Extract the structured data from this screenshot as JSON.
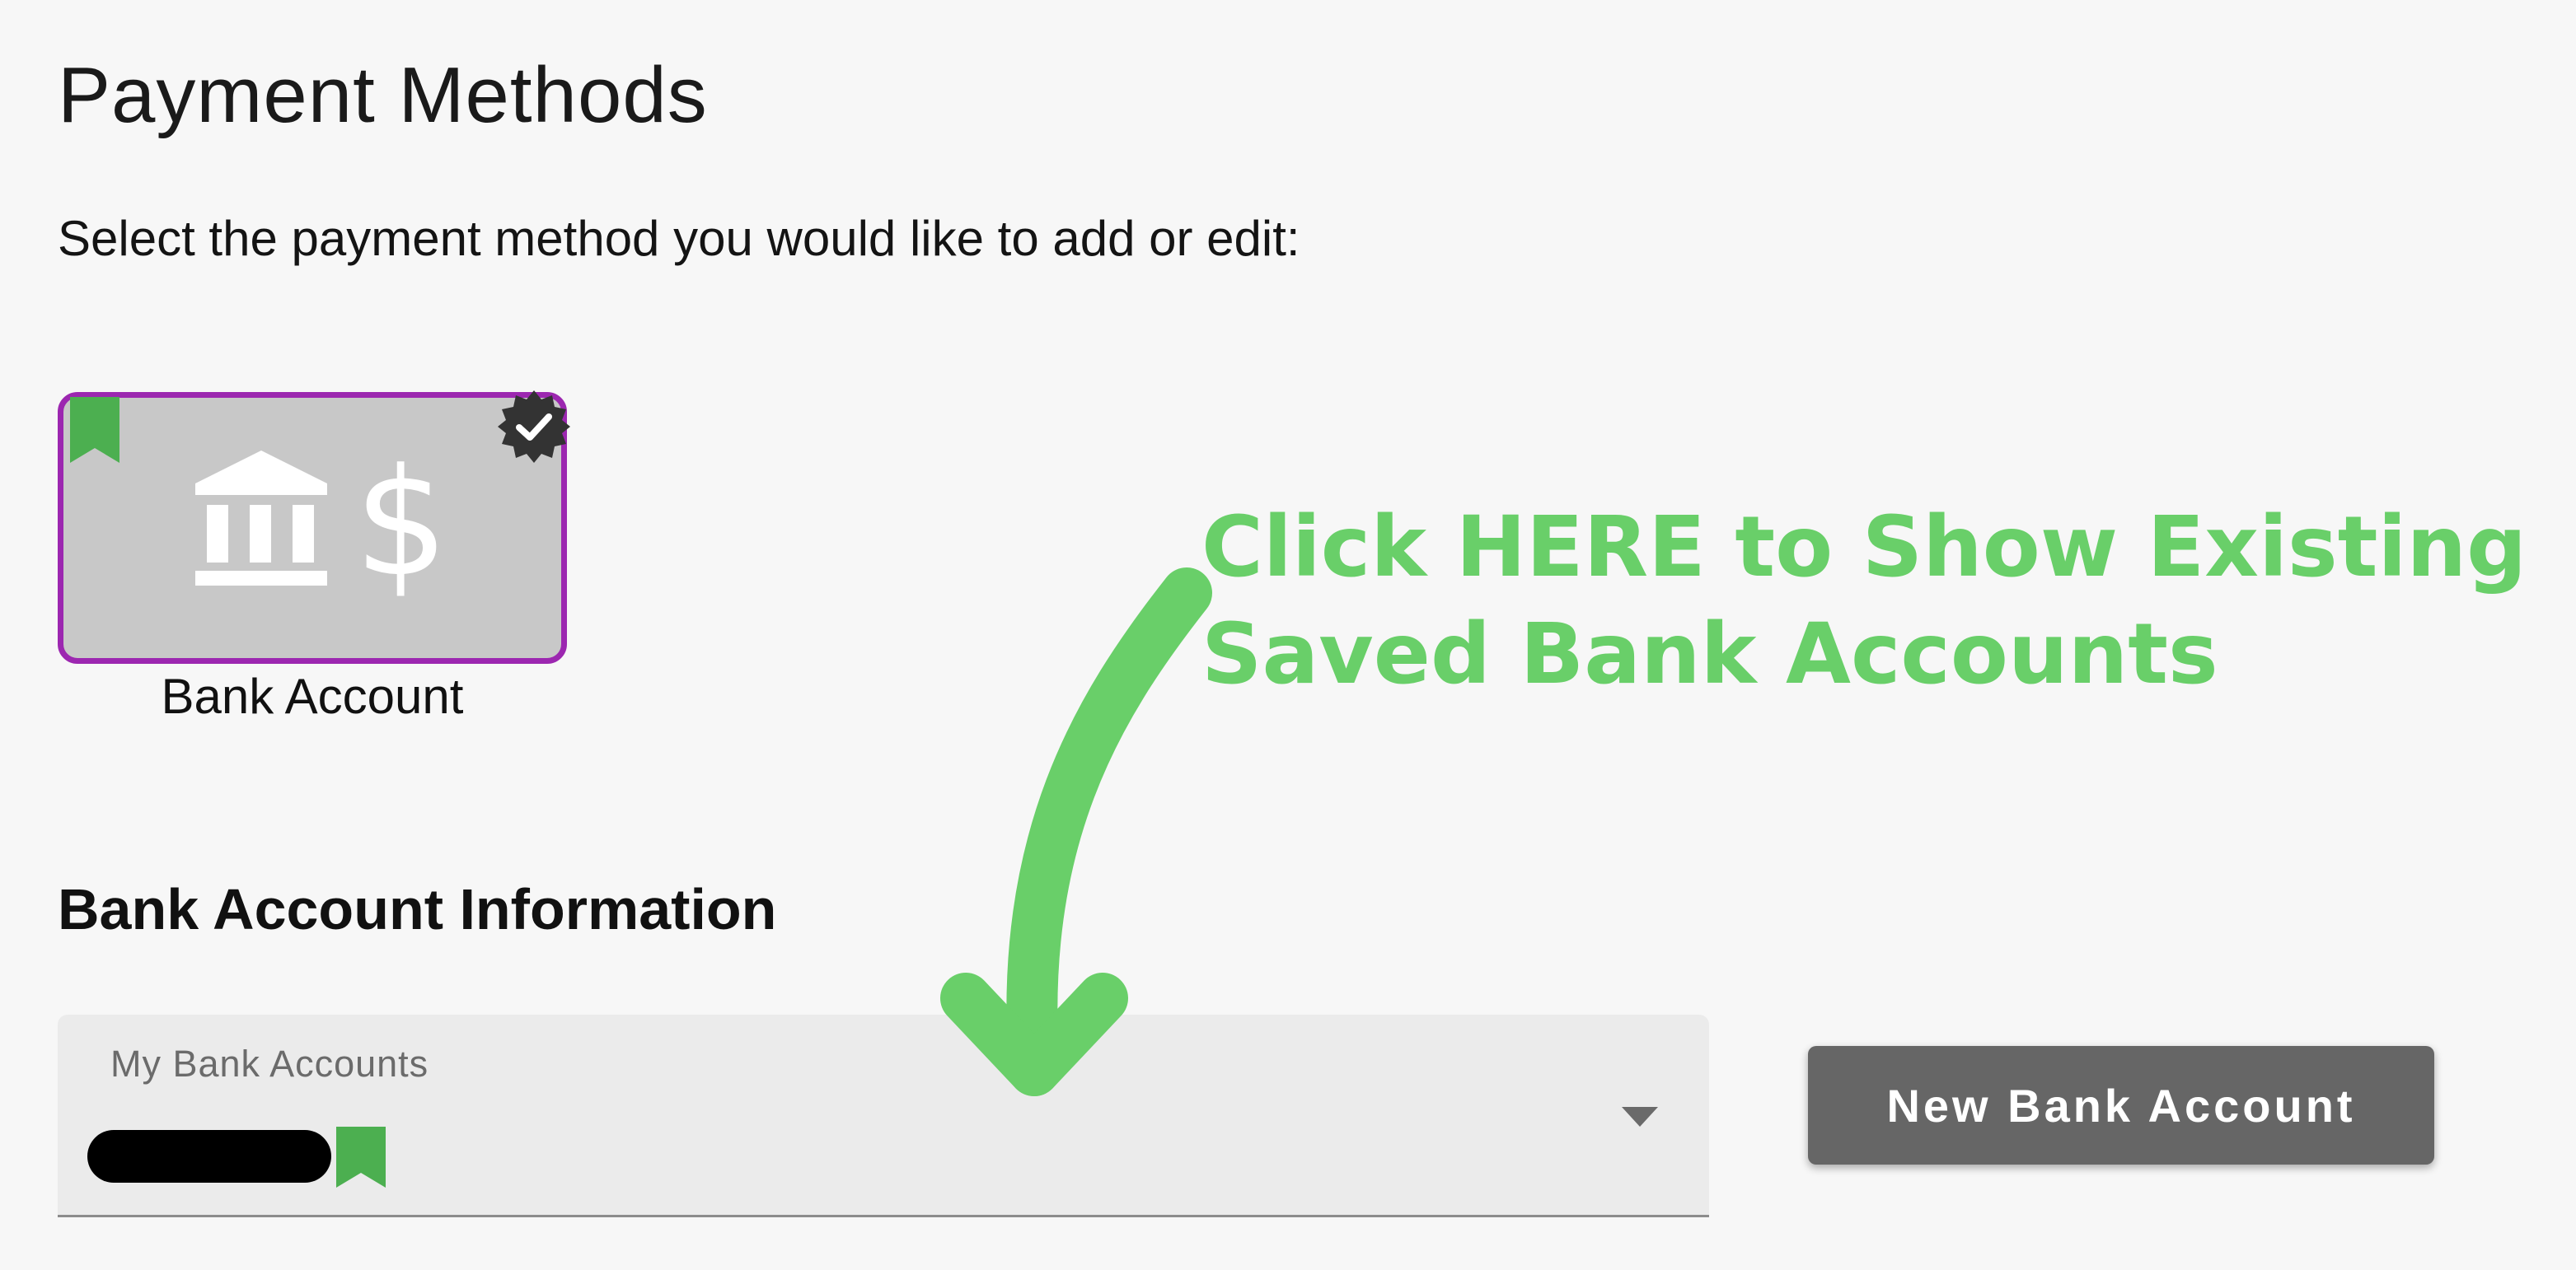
{
  "page": {
    "title": "Payment Methods",
    "instructions": "Select the payment method you would like to add or edit:"
  },
  "payment_method": {
    "label": "Bank Account",
    "icon": "bank-dollar-icon",
    "selected": true,
    "accent_color": "#9c27b0",
    "bookmark_color": "#4caf50"
  },
  "bank_section": {
    "heading": "Bank Account Information",
    "select": {
      "label": "My Bank Accounts",
      "value": "",
      "value_redacted": true
    },
    "new_account_label": "New Bank Account"
  },
  "annotation": {
    "line1": "Click HERE to Show Existing",
    "line2": "Saved Bank Accounts",
    "color": "#69cf69"
  }
}
